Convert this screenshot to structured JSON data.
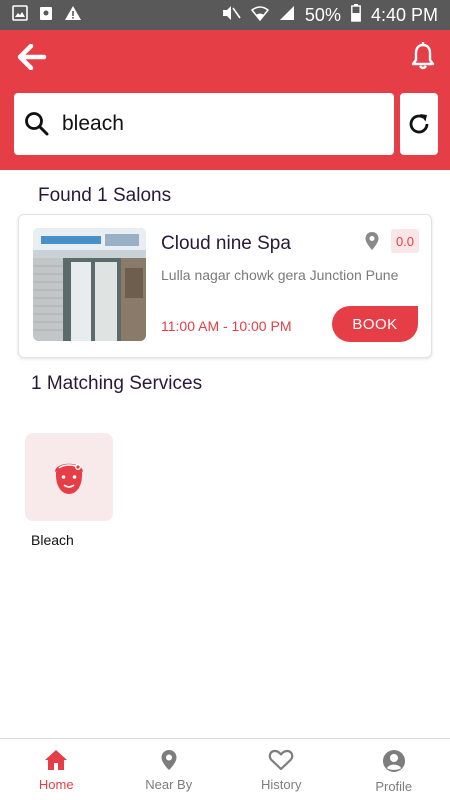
{
  "status_bar": {
    "battery": "50%",
    "time": "4:40 PM"
  },
  "colors": {
    "accent": "#e53e46",
    "status_bar": "#595959",
    "title_text": "#2a1838",
    "service_tile_bg": "#f8e9ea"
  },
  "search": {
    "value": "bleach"
  },
  "salons_section": {
    "title": "Found 1 Salons"
  },
  "salon": {
    "name": "Cloud nine Spa",
    "rating": "0.0",
    "address": "Lulla nagar chowk gera Junction Pune",
    "hours": "11:00 AM - 10:00 PM",
    "book_label": "BOOK"
  },
  "services_section": {
    "title": "1 Matching Services",
    "items": [
      {
        "label": "Bleach",
        "icon": "face-mask-icon"
      }
    ]
  },
  "bottom_nav": {
    "items": [
      {
        "label": "Home",
        "icon": "home-icon",
        "active": true
      },
      {
        "label": "Near By",
        "icon": "location-pin-icon",
        "active": false
      },
      {
        "label": "History",
        "icon": "heart-icon",
        "active": false
      },
      {
        "label": "Profile",
        "icon": "profile-icon",
        "active": false
      }
    ]
  }
}
